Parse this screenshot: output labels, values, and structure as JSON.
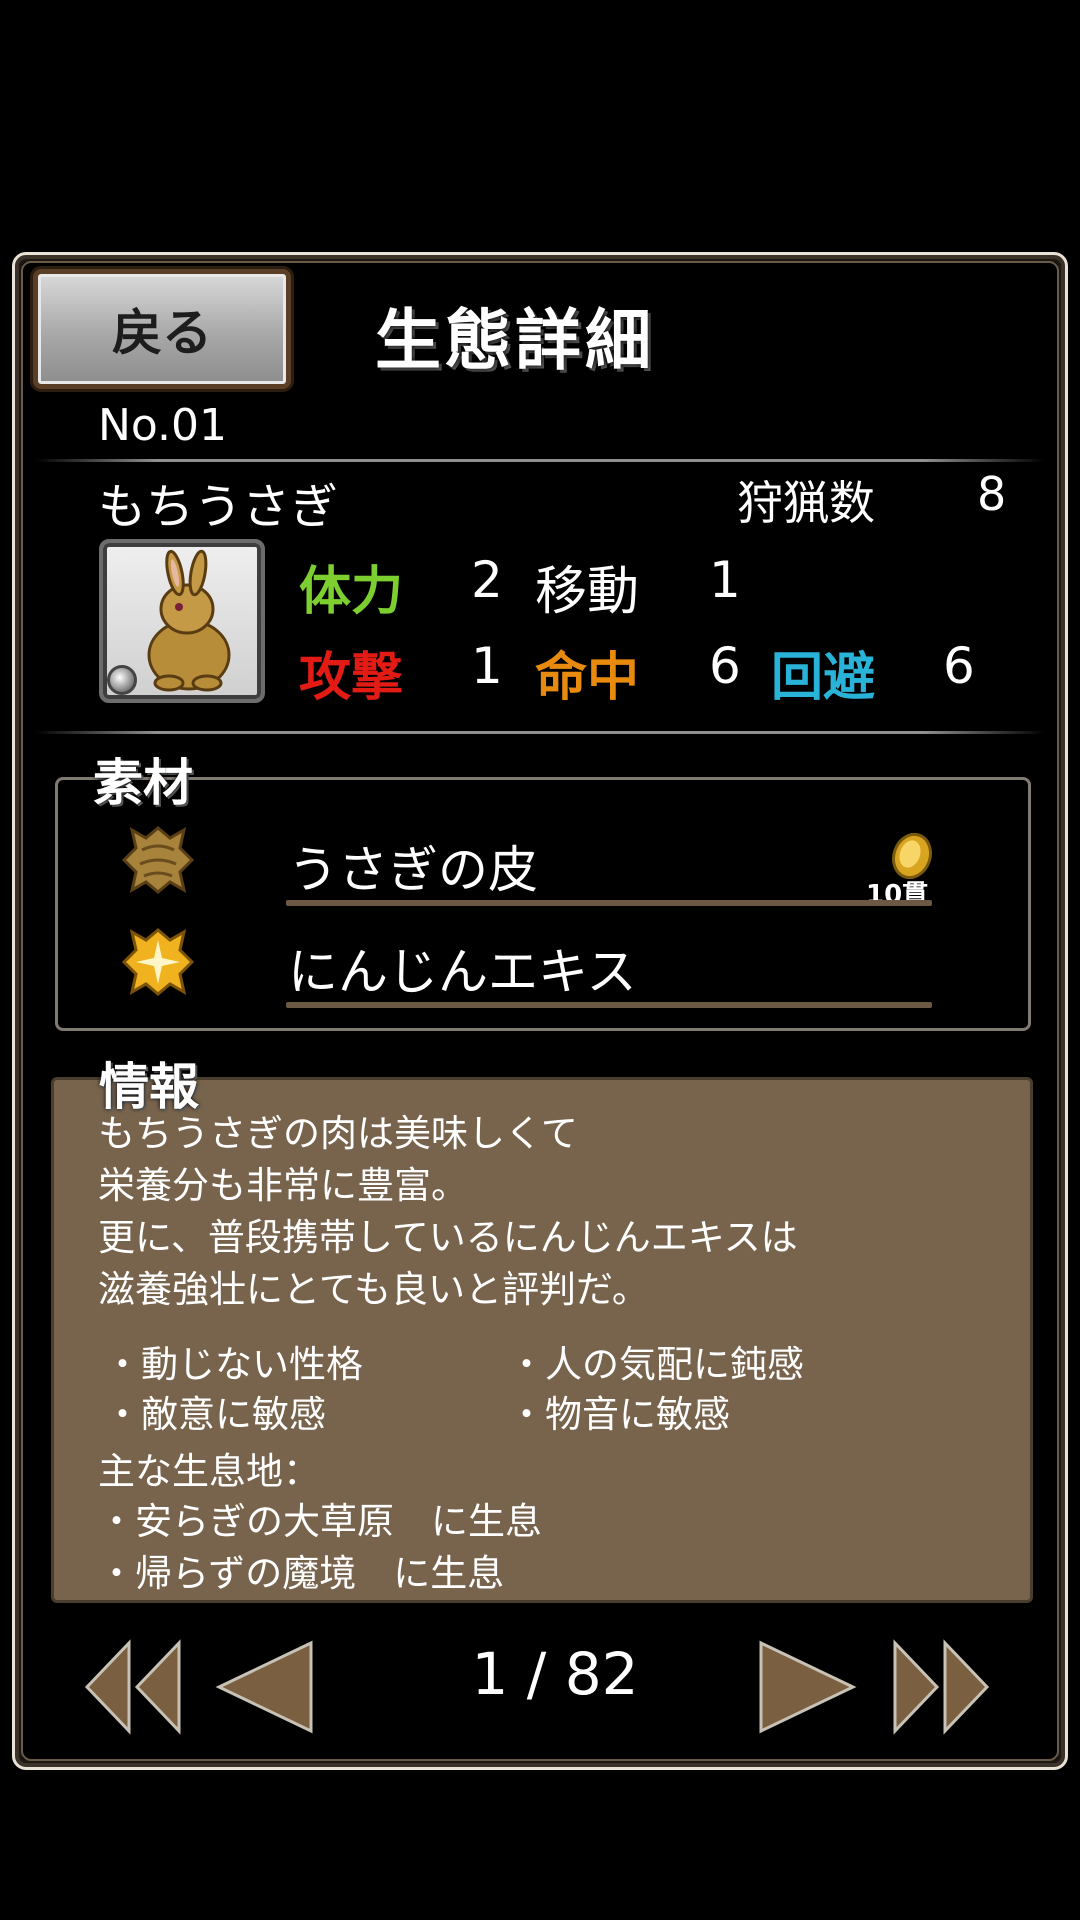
{
  "header": {
    "back_label": "戻る",
    "title": "生態詳細"
  },
  "creature": {
    "number": "No.01",
    "name": "もちうさぎ",
    "hunt_label": "狩猟数",
    "hunt_count": "8",
    "stats": [
      {
        "label": "体力",
        "value": "2",
        "color": "#7ccf2e"
      },
      {
        "label": "移動",
        "value": "1",
        "color": "#ffffff"
      },
      {
        "label": "攻撃",
        "value": "1",
        "color": "#e21b14"
      },
      {
        "label": "命中",
        "value": "6",
        "color": "#e88a0e"
      },
      {
        "label": "回避",
        "value": "6",
        "color": "#2ab3d8"
      }
    ]
  },
  "materials": {
    "label": "素材",
    "items": [
      {
        "name": "うさぎの皮",
        "icon": "hide-material-icon",
        "price": "10貫"
      },
      {
        "name": "にんじんエキス",
        "icon": "sparkle-material-icon"
      }
    ]
  },
  "info": {
    "label": "情報",
    "description": [
      "もちうさぎの肉は美味しくて",
      "栄養分も非常に豊富。",
      "更に、普段携帯しているにんじんエキスは",
      "滋養強壮にとても良いと評判だ。"
    ],
    "traits": [
      "・動じない性格",
      "・人の気配に鈍感",
      "・敵意に敏感",
      "・物音に敏感"
    ],
    "habitat_label": "主な生息地：",
    "habitats": [
      "・安らぎの大草原　に生息",
      "・帰らずの魔境　に生息"
    ]
  },
  "pager": {
    "text": "1 / 82",
    "icons": [
      "first-page-icon",
      "prev-page-icon",
      "next-page-icon",
      "last-page-icon"
    ]
  },
  "colors": {
    "panel_border": "#e9e2d6",
    "info_bg": "#78634c",
    "arrow_fill": "#7a6040"
  }
}
